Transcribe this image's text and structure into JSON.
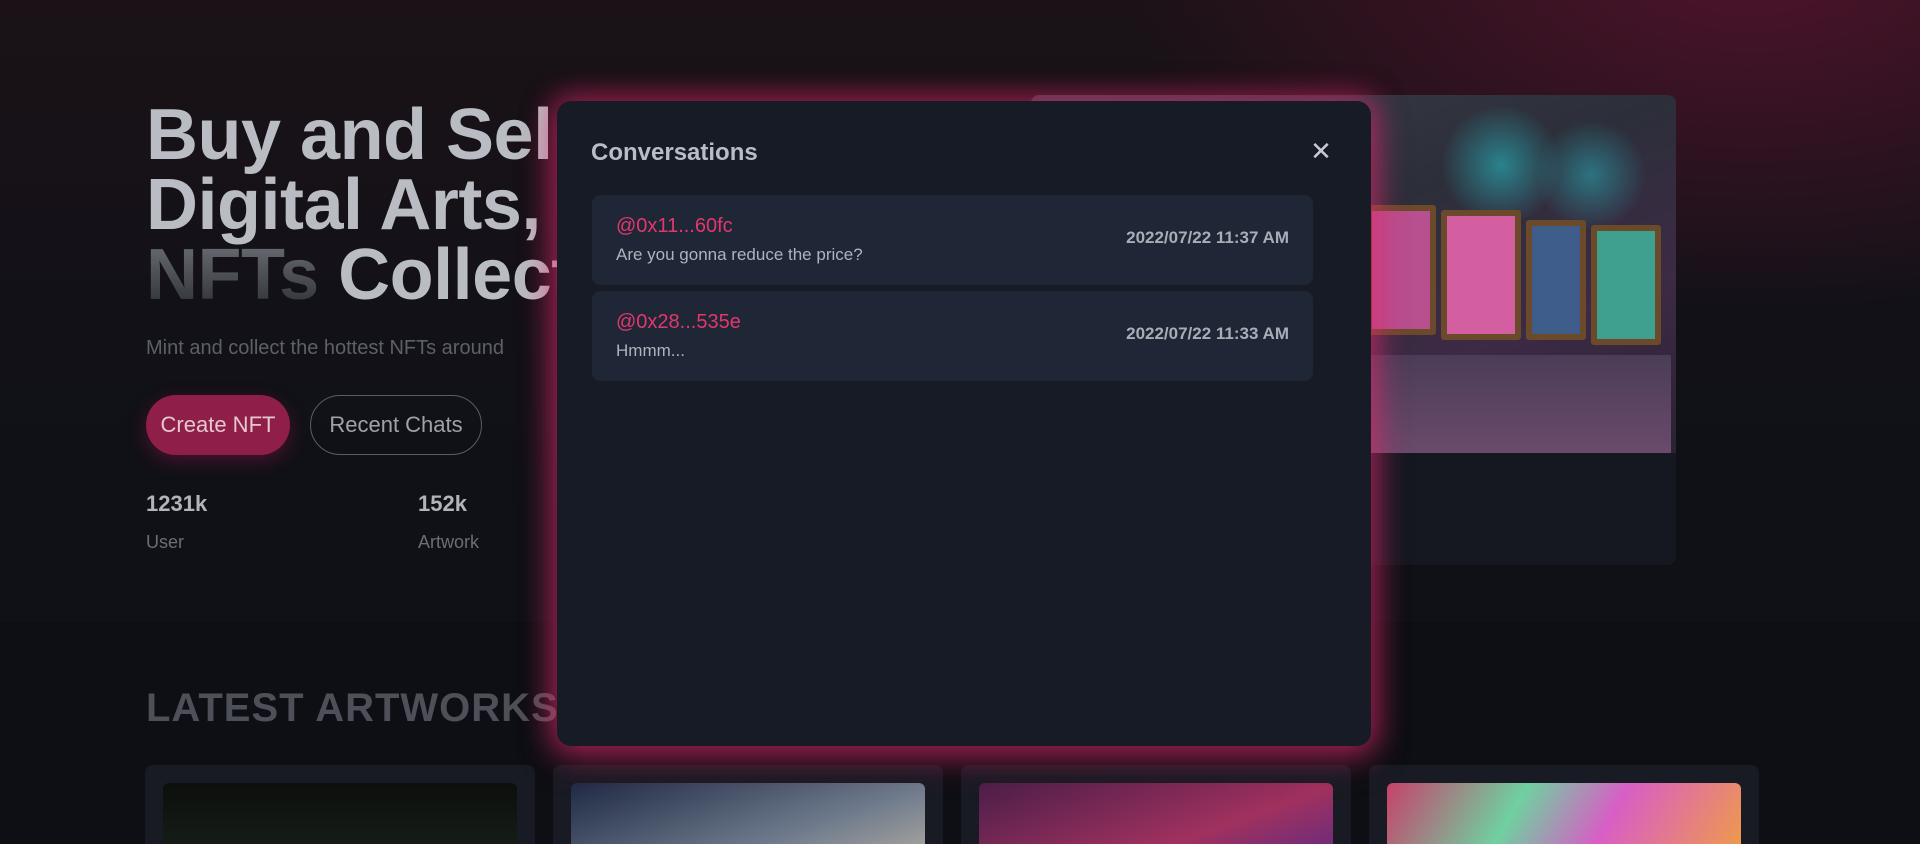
{
  "hero": {
    "title_line1": "Buy and Sel",
    "title_line2": "Digital Arts,",
    "title_line3_accent": "NFTs",
    "title_line3_rest": "Collect",
    "subtitle": "Mint and collect the hottest NFTs around",
    "create_button": "Create NFT",
    "recent_button": "Recent Chats"
  },
  "stats": [
    {
      "value": "1231k",
      "label": "User"
    },
    {
      "value": "152k",
      "label": "Artwork"
    }
  ],
  "latest": {
    "title": "LATEST ARTWORKS"
  },
  "modal": {
    "title": "Conversations",
    "close_symbol": "✕",
    "conversations": [
      {
        "name": "@0x11...60fc",
        "message": "Are you gonna reduce the price?",
        "time": "2022/07/22 11:37 AM"
      },
      {
        "name": "@0x28...535e",
        "message": "Hmmm...",
        "time": "2022/07/22 11:33 AM"
      }
    ]
  },
  "colors": {
    "accent": "#e0386e",
    "create_button_bg": "#8f1f48",
    "modal_bg": "#161b26",
    "conversation_bg": "#1f2635"
  },
  "icons": {
    "close": "close-icon"
  }
}
